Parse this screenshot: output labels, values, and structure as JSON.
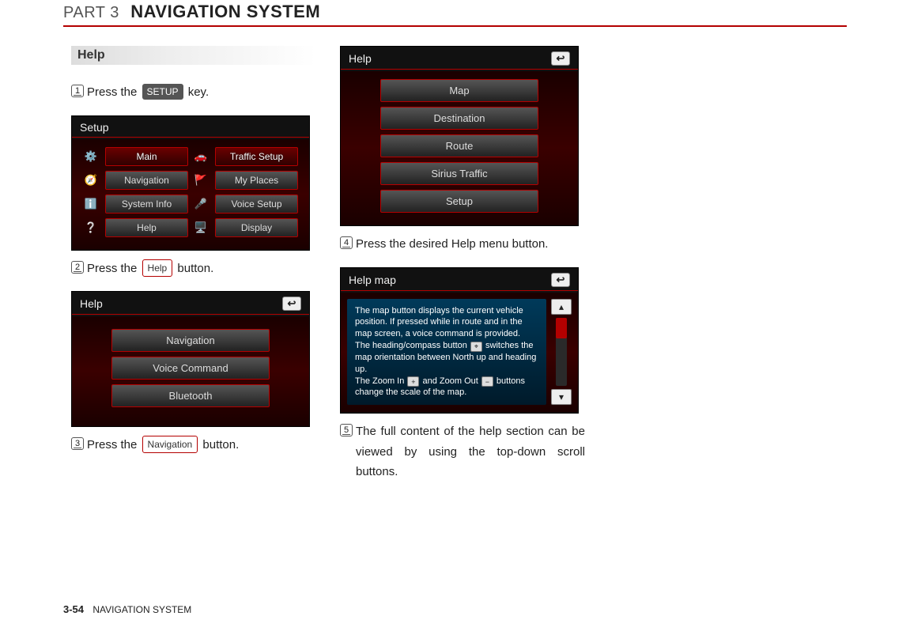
{
  "header": {
    "part": "PART 3",
    "title": "NAVIGATION SYSTEM"
  },
  "section": {
    "title": "Help"
  },
  "steps": {
    "s1": {
      "num": "1",
      "pre": "Press the ",
      "key": "SETUP",
      "post": " key."
    },
    "s2": {
      "num": "2",
      "pre": "Press the ",
      "btn": "Help",
      "post": " button."
    },
    "s3": {
      "num": "3",
      "pre": " Press the ",
      "btn": "Navigation",
      "post": " button."
    },
    "s4": {
      "num": "4",
      "text": " Press the desired Help menu button."
    },
    "s5": {
      "num": "5",
      "text": "The full content of the help section can be viewed by using the top-down scroll buttons."
    }
  },
  "shot_setup": {
    "title": "Setup",
    "items": {
      "main": "Main",
      "traffic": "Traffic Setup",
      "nav": "Navigation",
      "places": "My Places",
      "sys": "System Info",
      "voice": "Voice Setup",
      "help": "Help",
      "display": "Display"
    }
  },
  "shot_help1": {
    "title": "Help",
    "items": {
      "nav": "Navigation",
      "voice": "Voice Command",
      "bt": "Bluetooth"
    }
  },
  "shot_help2": {
    "title": "Help",
    "items": {
      "map": "Map",
      "dest": "Destination",
      "route": "Route",
      "sirius": "Sirius Traffic",
      "setup": "Setup"
    }
  },
  "shot_helpmap": {
    "title": "Help map",
    "l1": "The map button displays the current vehicle position. If pressed while in route and in the map screen, a voice command is provided.",
    "l2a": "The heading/compass button ",
    "l2b": " switches the map orientation between North up and heading up.",
    "l3a": "The Zoom In ",
    "l3b": " and Zoom Out ",
    "l3c": " buttons change the scale of the map."
  },
  "footer": {
    "page": "3-54",
    "label": "NAVIGATION SYSTEM"
  }
}
